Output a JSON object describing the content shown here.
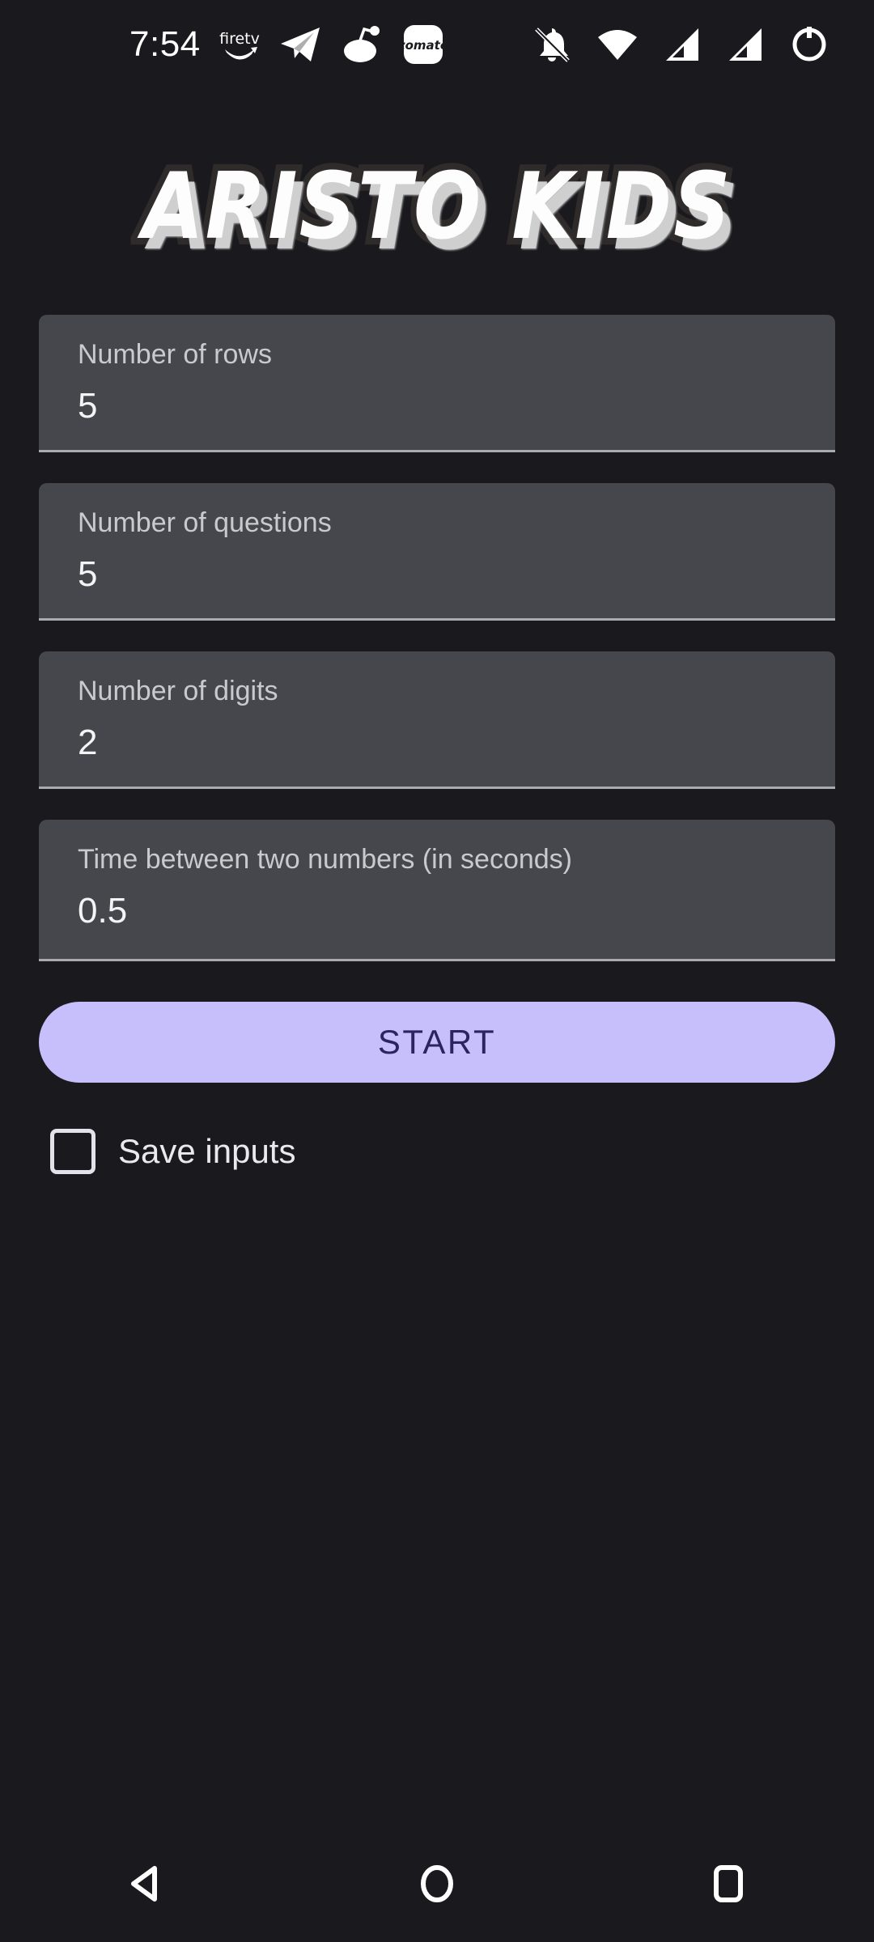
{
  "status_bar": {
    "clock": "7:54",
    "notification_icons": [
      {
        "name": "firetv-icon",
        "label": "firetv"
      },
      {
        "name": "telegram-icon",
        "label": "telegram"
      },
      {
        "name": "reddit-icon",
        "label": "reddit"
      },
      {
        "name": "zomato-icon",
        "label": "zomato"
      }
    ],
    "system_icons": [
      {
        "name": "notifications-silenced-icon",
        "label": "silent"
      },
      {
        "name": "wifi-icon",
        "label": "wifi"
      },
      {
        "name": "signal-sim1-icon",
        "label": "signal 1"
      },
      {
        "name": "signal-sim2-icon",
        "label": "signal 2"
      },
      {
        "name": "battery-icon",
        "label": "battery"
      }
    ]
  },
  "app": {
    "logo_text": "ARISTO KIDS"
  },
  "form": {
    "fields": [
      {
        "label": "Number of rows",
        "value": "5"
      },
      {
        "label": "Number of questions",
        "value": "5"
      },
      {
        "label": "Number of digits",
        "value": "2"
      },
      {
        "label": "Time between two numbers (in seconds)",
        "value": "0.5"
      }
    ]
  },
  "actions": {
    "start_label": "START",
    "save_inputs_label": "Save inputs",
    "save_inputs_checked": false
  },
  "nav_bar": {
    "back_label": "Back",
    "home_label": "Home",
    "recents_label": "Recents"
  },
  "colors": {
    "background": "#1a1a1e",
    "field_background": "#46464d",
    "field_underline": "#a9abb1",
    "accent": "#c7befc",
    "accent_text": "#2c2360",
    "label_text": "#c9c9ce",
    "value_text": "#f4f4f6"
  }
}
